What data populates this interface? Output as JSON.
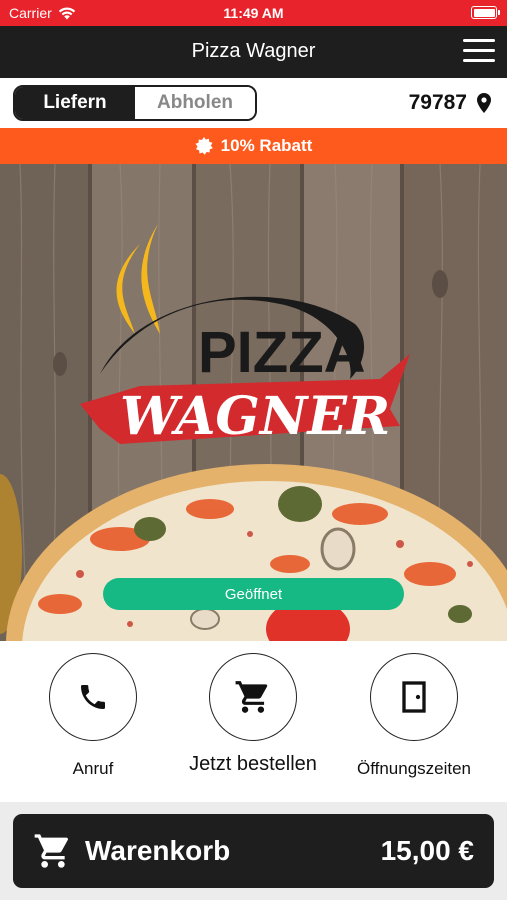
{
  "status": {
    "carrier": "Carrier",
    "time": "11:49 AM"
  },
  "nav": {
    "title": "Pizza Wagner"
  },
  "mode": {
    "deliver": "Liefern",
    "pickup": "Abholen",
    "zip": "79787"
  },
  "promo": {
    "text": "10% Rabatt"
  },
  "hero": {
    "logo_top": "PIZZA",
    "logo_bottom": "WAGNER",
    "status": "Geöffnet"
  },
  "actions": {
    "call": "Anruf",
    "order": "Jetzt bestellen",
    "hours": "Öffnungszeiten"
  },
  "cart": {
    "label": "Warenkorb",
    "total": "15,00 €"
  },
  "colors": {
    "brand_red": "#e8232b",
    "promo_orange": "#ff5a1e",
    "open_green": "#16b883",
    "dark": "#1e1e1e"
  }
}
